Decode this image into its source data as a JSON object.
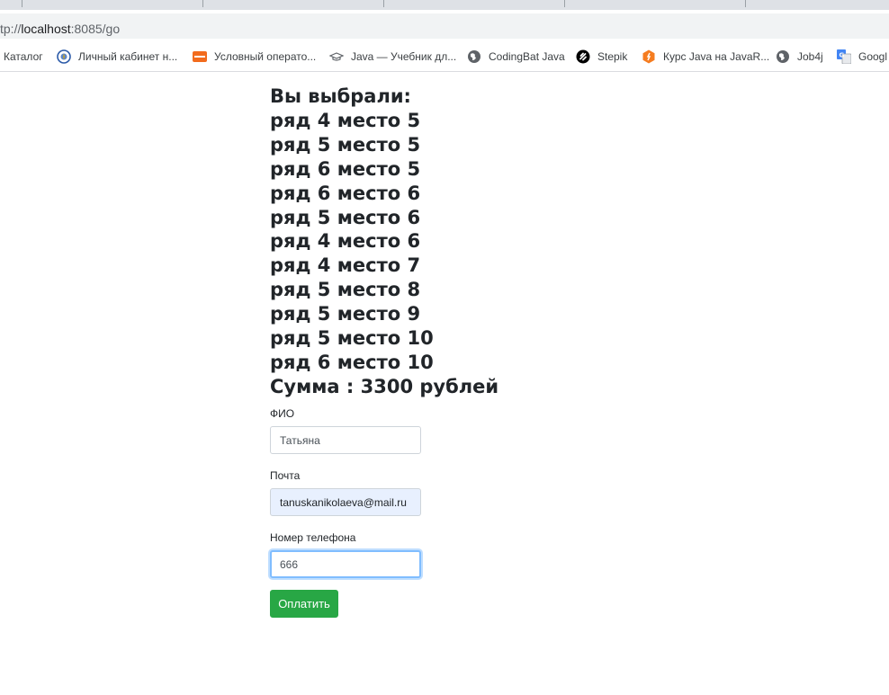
{
  "browser": {
    "url_prefix": "tp://",
    "url_host": "localhost",
    "url_rest": ":8085/go",
    "bookmarks": [
      {
        "label": "Каталог",
        "icon": "none"
      },
      {
        "label": "Личный кабинет н...",
        "icon": "emblem-icon"
      },
      {
        "label": "Условный операто...",
        "icon": "cyberforum-icon"
      },
      {
        "label": "Java — Учебник дл...",
        "icon": "hat-icon"
      },
      {
        "label": "CodingBat Java",
        "icon": "globe-icon"
      },
      {
        "label": "Stepik",
        "icon": "stepik-icon"
      },
      {
        "label": "Курс Java на JavaR...",
        "icon": "javarush-icon"
      },
      {
        "label": "Job4j",
        "icon": "globe-icon"
      },
      {
        "label": "Googl",
        "icon": "google-translate-icon"
      }
    ]
  },
  "page": {
    "heading": "Вы выбрали:",
    "seats": [
      "ряд 4 место 5",
      "ряд 5 место 5",
      "ряд 6 место 5",
      "ряд 6 место 6",
      "ряд 5 место 6",
      "ряд 4 место 6",
      "ряд 4 место 7",
      "ряд 5 место 8",
      "ряд 5 место 9",
      "ряд 5 место 10",
      "ряд 6 место 10"
    ],
    "total": "Сумма : 3300 рублей"
  },
  "form": {
    "fio_label": "ФИО",
    "fio_value": "Татьяна",
    "email_label": "Почта",
    "email_value": "tanuskanikolaeva@mail.ru",
    "phone_label": "Номер телефона",
    "phone_value": "666",
    "pay_button": "Оплатить"
  },
  "colors": {
    "pay_button": "#28a745",
    "text": "#212529",
    "autofill": "#e8f0fe",
    "focus": "#80bdff"
  }
}
